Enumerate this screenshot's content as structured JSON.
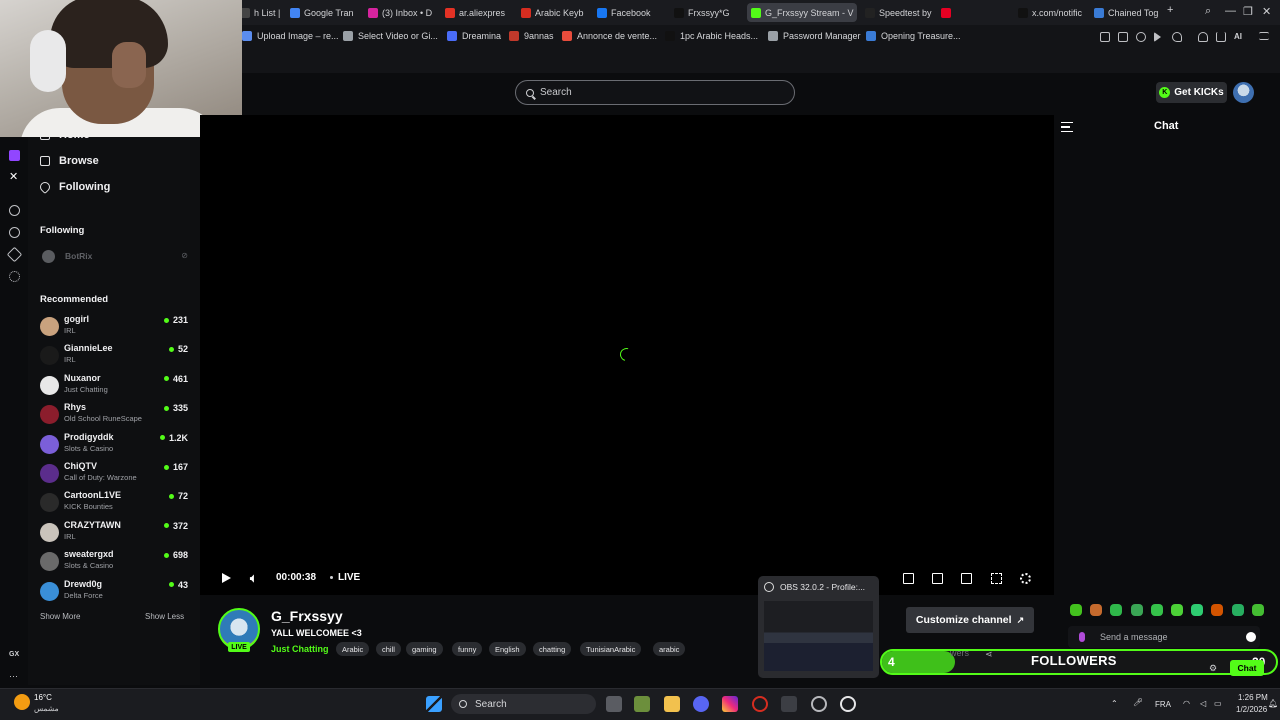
{
  "browser": {
    "tabs": [
      {
        "label": "h List | S",
        "icon": "list-icon",
        "color": "#444"
      },
      {
        "label": "Google Tran",
        "icon": "google-translate-icon",
        "color": "#4285f4"
      },
      {
        "label": "(3) Inbox • D",
        "icon": "instagram-icon",
        "color": "#d6249f"
      },
      {
        "label": "ar.aliexpres",
        "icon": "aliexpress-icon",
        "color": "#e43225"
      },
      {
        "label": "Arabic Keyb",
        "icon": "keyboard-icon",
        "color": "#d62d20"
      },
      {
        "label": "Facebook",
        "icon": "facebook-icon",
        "color": "#1877f2"
      },
      {
        "label": "Frxssyy*G",
        "icon": "tiktok-icon",
        "color": "#111"
      },
      {
        "label": "G_Frxssyy Stream - V",
        "icon": "kick-icon",
        "color": "#53fc18",
        "active": true
      },
      {
        "label": "Speedtest by",
        "icon": "speedtest-icon",
        "color": "#222"
      },
      {
        "label": "",
        "icon": "pinterest-icon",
        "color": "#e60023"
      },
      {
        "label": "x.com/notific",
        "icon": "x-icon",
        "color": "#111"
      },
      {
        "label": "Chained Tog",
        "icon": "game-icon",
        "color": "#3a7bd5"
      }
    ],
    "bookmarks": [
      {
        "label": "Upload Image – re...",
        "color": "#5b8def"
      },
      {
        "label": "Select Video or Gi...",
        "color": "#9aa0a6"
      },
      {
        "label": "Dreamina",
        "color": "#4a6cf7"
      },
      {
        "label": "9annas",
        "color": "#c0392b"
      },
      {
        "label": "Annonce de vente...",
        "color": "#e74c3c"
      },
      {
        "label": "1pc Arabic Heads...",
        "color": "#111111"
      },
      {
        "label": "Password Manager",
        "color": "#9aa0a6"
      },
      {
        "label": "Opening Treasure...",
        "color": "#3a7bd5"
      }
    ],
    "ai_label": "AI"
  },
  "header": {
    "search_placeholder": "Search",
    "get_kicks": "Get KICKs"
  },
  "sidebar": {
    "nav": [
      {
        "label": "Home",
        "icon": "home-icon"
      },
      {
        "label": "Browse",
        "icon": "browse-icon"
      },
      {
        "label": "Following",
        "icon": "heart-icon"
      }
    ],
    "following_title": "Following",
    "following": [
      {
        "name": "BotRix"
      }
    ],
    "recommended_title": "Recommended",
    "recommended": [
      {
        "name": "gogirl",
        "category": "IRL",
        "viewers": "231",
        "color": "#c9a27e"
      },
      {
        "name": "GiannieLee",
        "category": "IRL",
        "viewers": "52",
        "color": "#1a1a1a"
      },
      {
        "name": "Nuxanor",
        "category": "Just Chatting",
        "viewers": "461",
        "color": "#e8e8e8"
      },
      {
        "name": "Rhys",
        "category": "Old School RuneScape",
        "viewers": "335",
        "color": "#8b1d2c"
      },
      {
        "name": "Prodigyddk",
        "category": "Slots & Casino",
        "viewers": "1.2K",
        "color": "#7b5fd9"
      },
      {
        "name": "ChiQTV",
        "category": "Call of Duty: Warzone",
        "viewers": "167",
        "color": "#5b2d8c"
      },
      {
        "name": "CartoonL1VE",
        "category": "KICK Bounties",
        "viewers": "72",
        "color": "#2a2a2a"
      },
      {
        "name": "CRAZYTAWN",
        "category": "IRL",
        "viewers": "372",
        "color": "#c9c3bb"
      },
      {
        "name": "sweatergxd",
        "category": "Slots & Casino",
        "viewers": "698",
        "color": "#6a6a6a"
      },
      {
        "name": "Drewd0g",
        "category": "Delta Force",
        "viewers": "43",
        "color": "#3a8fd8"
      }
    ],
    "show_more": "Show More",
    "show_less": "Show Less",
    "rail_bottom": "GX"
  },
  "player": {
    "time": "00:00:38",
    "live": "LIVE"
  },
  "channel": {
    "name": "G_Frxssyy",
    "title": "YALL WELCOMEE <3",
    "category": "Just Chatting",
    "live_badge": "LIVE",
    "tags": [
      "Arabic",
      "chill",
      "gaming",
      "funny",
      "English",
      "chatting",
      "TunisianArabic",
      "arabic"
    ],
    "customize": "Customize channel"
  },
  "obs_preview": {
    "title": "OBS 32.0.2 - Profile:..."
  },
  "chat": {
    "title": "Chat",
    "input_placeholder": "Send a message",
    "button": "Chat",
    "emote_colors": [
      "#43c21e",
      "#c56a2d",
      "#2fb84a",
      "#3aa655",
      "#35c24a",
      "#4cd137",
      "#2ecc71",
      "#d35400",
      "#27ae60",
      "#44bd32"
    ]
  },
  "overlay": {
    "followers_count": "4",
    "followers_label": "FOLLOWERS",
    "followers_goal": "20",
    "progress": 0.2,
    "hidden_text": "wers"
  },
  "taskbar": {
    "weather_temp": "16°C",
    "weather_desc": "مشمس",
    "search": "Search",
    "lang": "FRA",
    "time": "1:26 PM",
    "date": "1/2/2026"
  }
}
